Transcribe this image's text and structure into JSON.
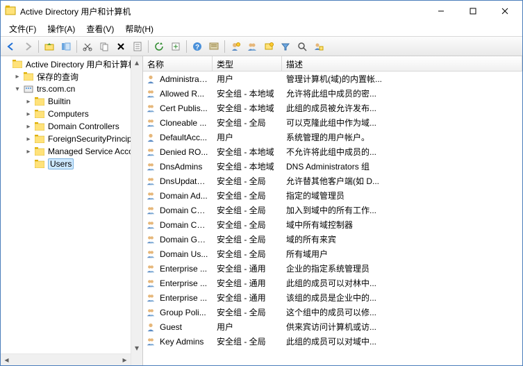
{
  "window": {
    "title": "Active Directory 用户和计算机",
    "min": "–",
    "max_icon": "max",
    "close": "×"
  },
  "menu": {
    "file": "文件(F)",
    "action": "操作(A)",
    "view": "查看(V)",
    "help": "帮助(H)"
  },
  "tree": {
    "root": "Active Directory 用户和计算机",
    "domain": "trs.com.cn",
    "nodes": {
      "saved": "保存的查询",
      "builtin": "Builtin",
      "computers": "Computers",
      "dc": "Domain Controllers",
      "fsp": "ForeignSecurityPrincipa",
      "msa": "Managed Service Acco",
      "users": "Users"
    }
  },
  "columns": {
    "name": "名称",
    "type": "类型",
    "desc": "描述"
  },
  "rows": [
    {
      "icon": "user",
      "name": "Administrat...",
      "type": "用户",
      "desc": "管理计算机(域)的内置帐..."
    },
    {
      "icon": "group",
      "name": "Allowed R...",
      "type": "安全组 - 本地域",
      "desc": "允许将此组中成员的密..."
    },
    {
      "icon": "group",
      "name": "Cert Publis...",
      "type": "安全组 - 本地域",
      "desc": "此组的成员被允许发布..."
    },
    {
      "icon": "group",
      "name": "Cloneable ...",
      "type": "安全组 - 全局",
      "desc": "可以克隆此组中作为域..."
    },
    {
      "icon": "user",
      "name": "DefaultAcc...",
      "type": "用户",
      "desc": "系统管理的用户帐户。"
    },
    {
      "icon": "group",
      "name": "Denied RO...",
      "type": "安全组 - 本地域",
      "desc": "不允许将此组中成员的..."
    },
    {
      "icon": "group",
      "name": "DnsAdmins",
      "type": "安全组 - 本地域",
      "desc": "DNS Administrators 组"
    },
    {
      "icon": "group",
      "name": "DnsUpdate...",
      "type": "安全组 - 全局",
      "desc": "允许替其他客户端(如 D..."
    },
    {
      "icon": "group",
      "name": "Domain Ad...",
      "type": "安全组 - 全局",
      "desc": "指定的域管理员"
    },
    {
      "icon": "group",
      "name": "Domain Co...",
      "type": "安全组 - 全局",
      "desc": "加入到域中的所有工作..."
    },
    {
      "icon": "group",
      "name": "Domain Co...",
      "type": "安全组 - 全局",
      "desc": "域中所有域控制器"
    },
    {
      "icon": "group",
      "name": "Domain Gu...",
      "type": "安全组 - 全局",
      "desc": "域的所有来宾"
    },
    {
      "icon": "group",
      "name": "Domain Us...",
      "type": "安全组 - 全局",
      "desc": "所有域用户"
    },
    {
      "icon": "group",
      "name": "Enterprise ...",
      "type": "安全组 - 通用",
      "desc": "企业的指定系统管理员"
    },
    {
      "icon": "group",
      "name": "Enterprise ...",
      "type": "安全组 - 通用",
      "desc": "此组的成员可以对林中..."
    },
    {
      "icon": "group",
      "name": "Enterprise ...",
      "type": "安全组 - 通用",
      "desc": "该组的成员是企业中的..."
    },
    {
      "icon": "group",
      "name": "Group Poli...",
      "type": "安全组 - 全局",
      "desc": "这个组中的成员可以修..."
    },
    {
      "icon": "user",
      "name": "Guest",
      "type": "用户",
      "desc": "供来宾访问计算机或访..."
    },
    {
      "icon": "group",
      "name": "Key Admins",
      "type": "安全组 - 全局",
      "desc": "此组的成员可以对域中..."
    }
  ]
}
